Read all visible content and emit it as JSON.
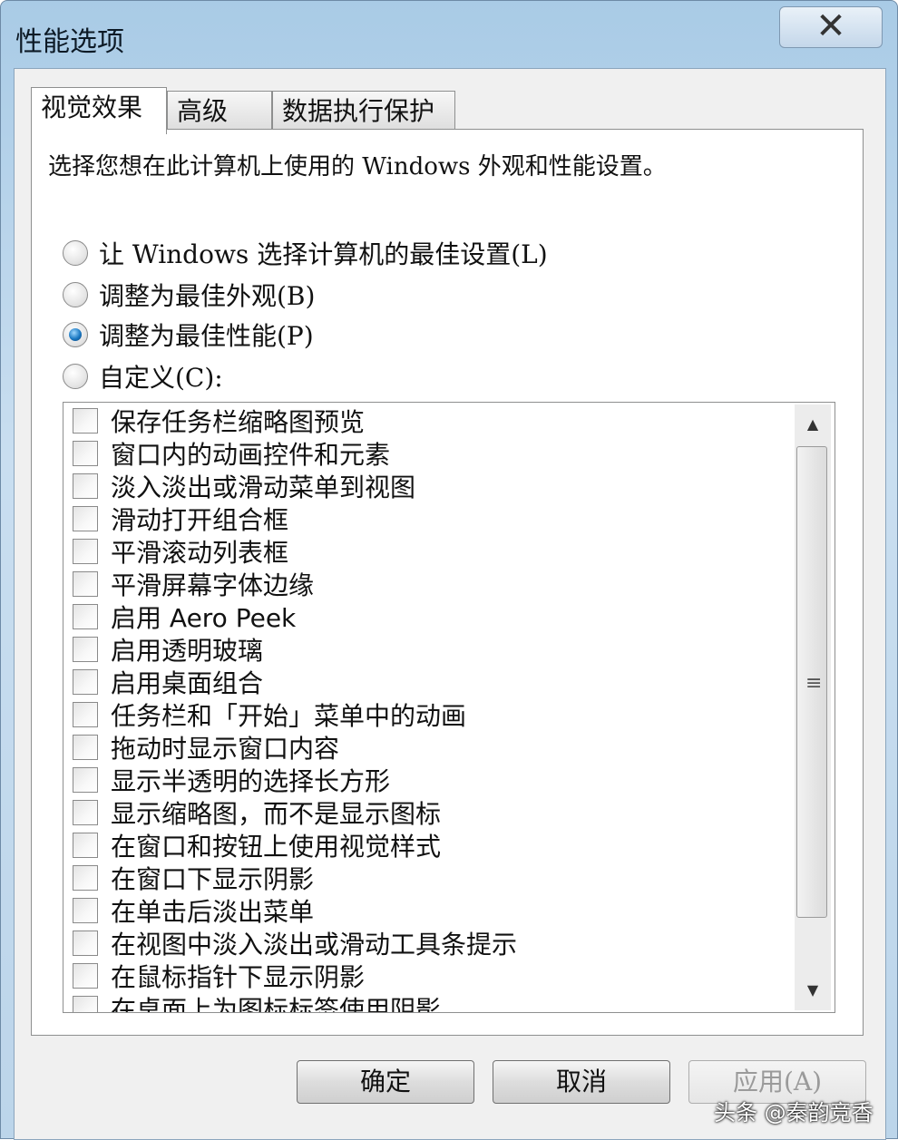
{
  "window": {
    "title": "性能选项",
    "close_glyph": "✕"
  },
  "tabs": [
    {
      "label": "视觉效果"
    },
    {
      "label": "高级"
    },
    {
      "label": "数据执行保护"
    }
  ],
  "description": "选择您想在此计算机上使用的 Windows 外观和性能设置。",
  "radios": [
    {
      "label": "让 Windows 选择计算机的最佳设置(L)",
      "checked": false
    },
    {
      "label": "调整为最佳外观(B)",
      "checked": false
    },
    {
      "label": "调整为最佳性能(P)",
      "checked": true
    },
    {
      "label": "自定义(C):",
      "checked": false
    }
  ],
  "effects": [
    "保存任务栏缩略图预览",
    "窗口内的动画控件和元素",
    "淡入淡出或滑动菜单到视图",
    "滑动打开组合框",
    "平滑滚动列表框",
    "平滑屏幕字体边缘",
    "启用 Aero Peek",
    "启用透明玻璃",
    "启用桌面组合",
    "任务栏和「开始」菜单中的动画",
    "拖动时显示窗口内容",
    "显示半透明的选择长方形",
    "显示缩略图，而不是显示图标",
    "在窗口和按钮上使用视觉样式",
    "在窗口下显示阴影",
    "在单击后淡出菜单",
    "在视图中淡入淡出或滑动工具条提示",
    "在鼠标指针下显示阴影",
    "在桌面上为图标标签使用阴影"
  ],
  "scrollbar": {
    "up_glyph": "▲",
    "down_glyph": "▼",
    "grip_glyph": "≡"
  },
  "buttons": {
    "ok": "确定",
    "cancel": "取消",
    "apply": "应用(A)"
  },
  "watermark": "头条 @秦韵竞香"
}
